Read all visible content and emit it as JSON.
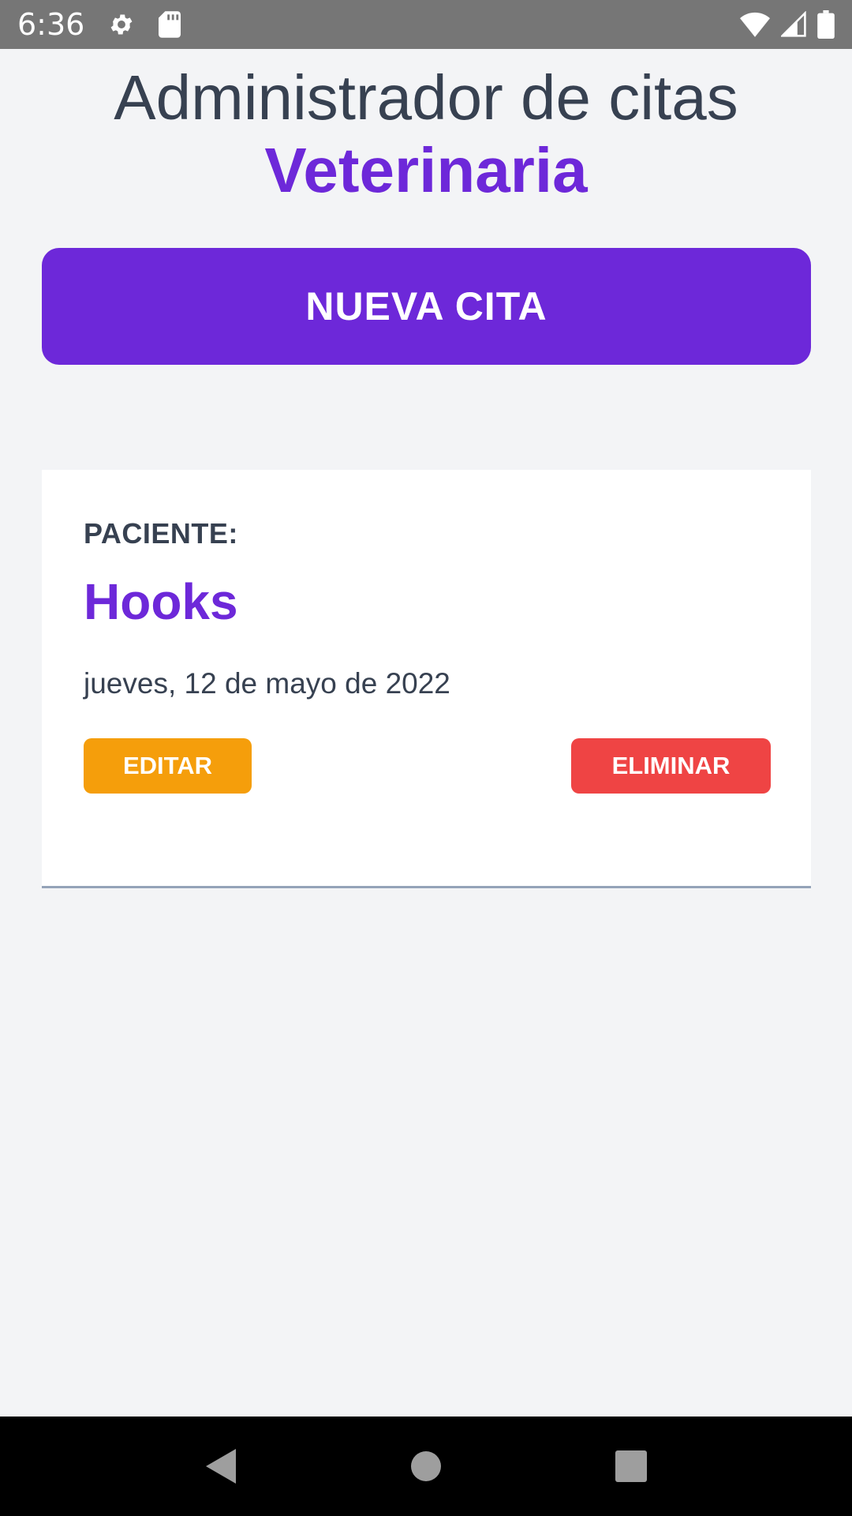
{
  "status_bar": {
    "time": "6:36",
    "icons_left": [
      "gear-icon",
      "sd-card-icon"
    ],
    "icons_right": [
      "wifi-icon",
      "signal-icon",
      "battery-icon"
    ]
  },
  "header": {
    "title": "Administrador de citas",
    "title_accent": "Veterinaria"
  },
  "actions": {
    "new_appointment_label": "NUEVA CITA"
  },
  "appointments": [
    {
      "label": "PACIENTE:",
      "name": "Hooks",
      "date": "jueves, 12 de mayo de 2022",
      "edit_label": "EDITAR",
      "delete_label": "ELIMINAR"
    }
  ],
  "nav_bar": {
    "icons": [
      "back-icon",
      "home-icon",
      "recents-icon"
    ]
  },
  "colors": {
    "accent": "#6d28d9",
    "edit": "#f59e0b",
    "delete": "#ef4444",
    "text": "#374151",
    "background": "#f3f4f6"
  }
}
